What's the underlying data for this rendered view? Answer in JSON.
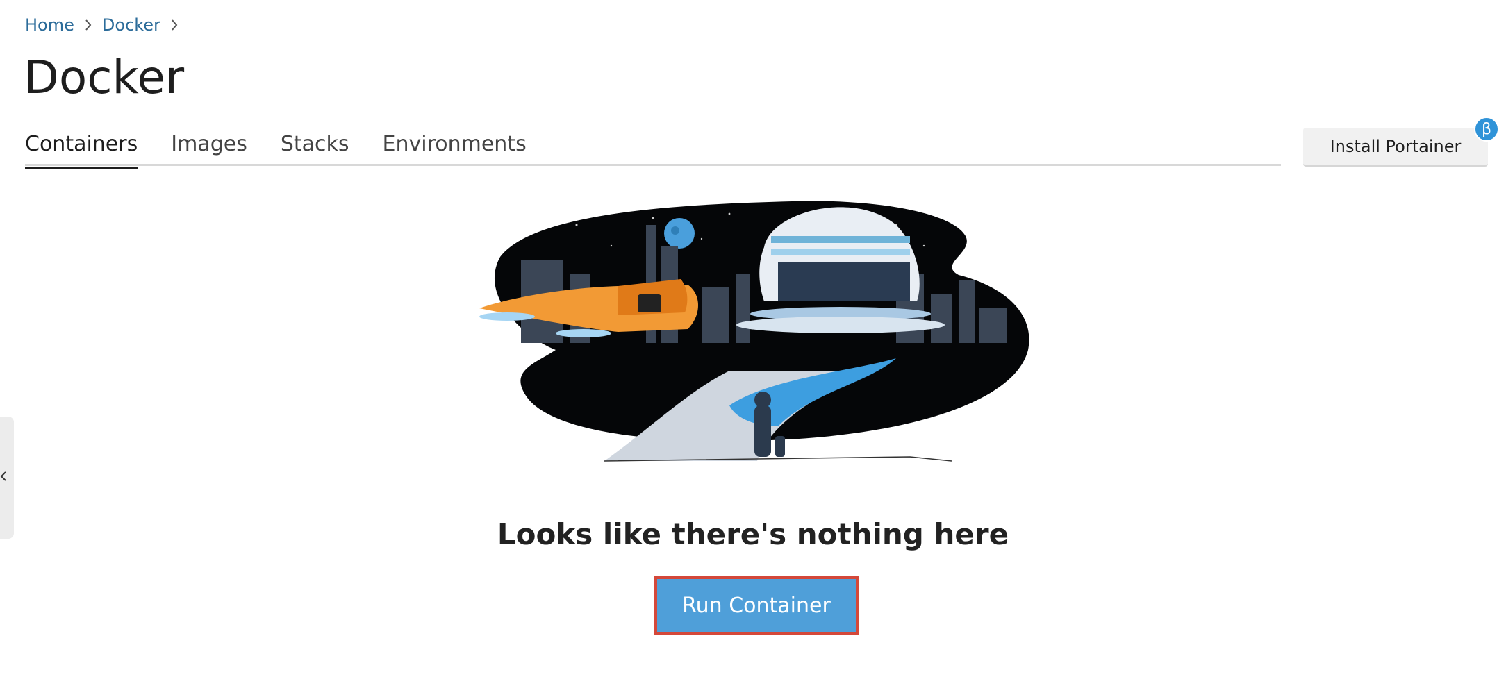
{
  "breadcrumb": {
    "items": [
      "Home",
      "Docker"
    ],
    "separator_icon": "chevron-right-icon"
  },
  "page": {
    "title": "Docker"
  },
  "tabs": [
    {
      "label": "Containers",
      "active": true
    },
    {
      "label": "Images",
      "active": false
    },
    {
      "label": "Stacks",
      "active": false
    },
    {
      "label": "Environments",
      "active": false
    }
  ],
  "install": {
    "label": "Install Portainer",
    "badge": "β"
  },
  "sidebar": {
    "toggle_icon": "chevron-left-icon"
  },
  "empty_state": {
    "illustration": "space-city-illustration",
    "message": "Looks like there's nothing here",
    "action_label": "Run Container"
  },
  "colors": {
    "link": "#2c6c9a",
    "primary_button": "#4f9fd9",
    "highlight_border": "#d4483a",
    "badge": "#2f93d8"
  }
}
